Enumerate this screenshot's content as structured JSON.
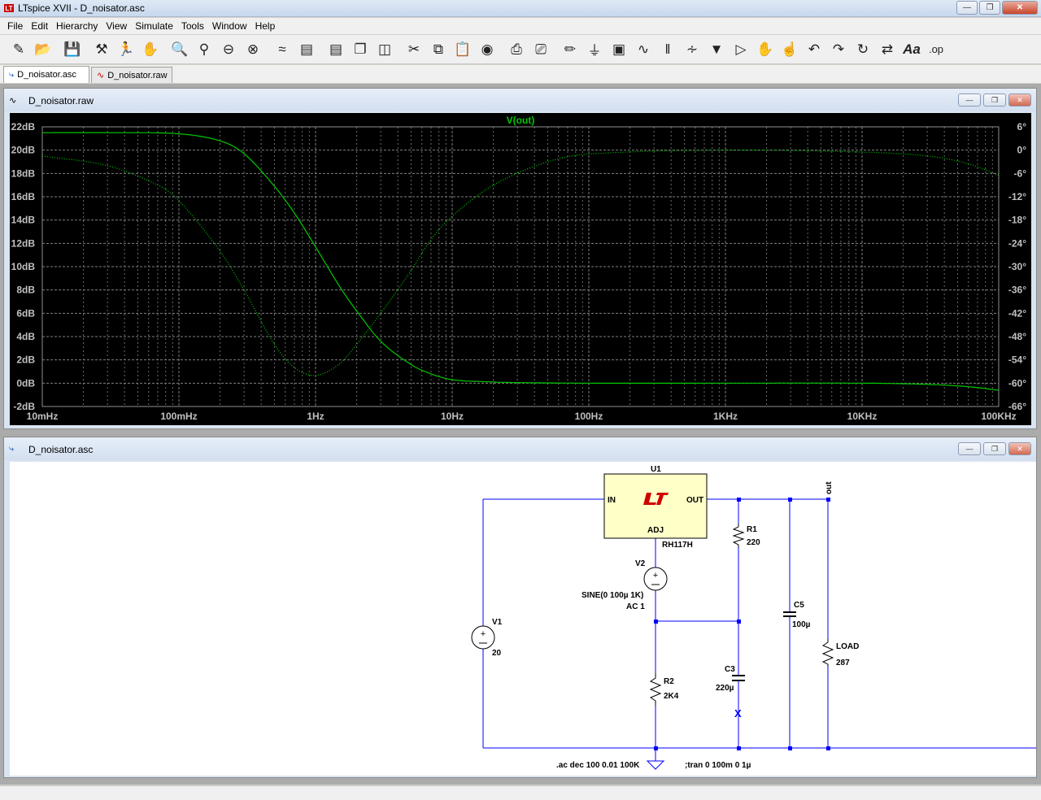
{
  "window": {
    "title": "LTspice XVII - D_noisator.asc"
  },
  "menu": [
    "File",
    "Edit",
    "Hierarchy",
    "View",
    "Simulate",
    "Tools",
    "Window",
    "Help"
  ],
  "tabs": [
    {
      "label": "D_noisator.asc",
      "active": true
    },
    {
      "label": "D_noisator.raw",
      "active": false
    }
  ],
  "plot_window": {
    "title": "D_noisator.raw"
  },
  "schematic_window": {
    "title": "D_noisator.asc"
  },
  "chart_data": {
    "type": "line",
    "title": "V(out)",
    "x_scale": "log",
    "xlim_hz": [
      0.01,
      100000
    ],
    "x_tick_labels": [
      "10mHz",
      "100mHz",
      "1Hz",
      "10Hz",
      "100Hz",
      "1KHz",
      "10KHz",
      "100KHz"
    ],
    "ylim_db": [
      -2,
      22
    ],
    "y_tick_labels": [
      "22dB",
      "20dB",
      "18dB",
      "16dB",
      "14dB",
      "12dB",
      "10dB",
      "8dB",
      "6dB",
      "4dB",
      "2dB",
      "0dB",
      "-2dB"
    ],
    "y2lim_deg": [
      -66,
      6
    ],
    "y2_tick_labels": [
      "6°",
      "0°",
      "-6°",
      "-12°",
      "-18°",
      "-24°",
      "-30°",
      "-36°",
      "-42°",
      "-48°",
      "-54°",
      "-60°",
      "-66°"
    ],
    "grid": true,
    "series": [
      {
        "name": "V(out)",
        "axis": "magnitude",
        "unit": "dB",
        "color": "#00c800",
        "x": [
          0.01,
          0.03,
          0.1,
          0.2,
          0.3,
          0.5,
          0.7,
          1,
          1.5,
          2,
          3,
          5,
          7,
          10,
          20,
          30,
          100,
          1000,
          10000,
          30000,
          60000,
          100000
        ],
        "y": [
          21.5,
          21.5,
          21.4,
          20.8,
          19.7,
          16.9,
          14.6,
          11.7,
          8.3,
          6.2,
          3.6,
          1.6,
          0.8,
          0.3,
          0.1,
          0.05,
          0.0,
          0.0,
          0.0,
          -0.1,
          -0.3,
          -0.6
        ]
      },
      {
        "name": "V(out) phase",
        "axis": "phase",
        "unit": "deg",
        "color": "#00c800",
        "dotted": true,
        "x": [
          0.01,
          0.03,
          0.07,
          0.1,
          0.2,
          0.3,
          0.5,
          0.7,
          1,
          1.5,
          2,
          3,
          5,
          7,
          10,
          20,
          50,
          100,
          1000,
          10000,
          30000,
          60000,
          100000
        ],
        "y": [
          -1.5,
          -4,
          -9,
          -13,
          -26,
          -36,
          -50,
          -56,
          -58,
          -55,
          -50,
          -42,
          -31,
          -23,
          -17,
          -9,
          -3,
          -1,
          0,
          -0.5,
          -1.5,
          -3.5,
          -6.5
        ]
      }
    ]
  },
  "schematic": {
    "regulator": {
      "ref": "U1",
      "part": "RH117H",
      "pin_in": "IN",
      "pin_out": "OUT",
      "pin_adj": "ADJ"
    },
    "V1": {
      "ref": "V1",
      "value": "20"
    },
    "V2": {
      "ref": "V2",
      "value": "SINE(0 100µ 1K)",
      "ac": "AC 1"
    },
    "R1": {
      "ref": "R1",
      "value": "220"
    },
    "R2": {
      "ref": "R2",
      "value": "2K4"
    },
    "C3": {
      "ref": "C3",
      "value": "220µ"
    },
    "C5": {
      "ref": "C5",
      "value": "100µ"
    },
    "LOAD": {
      "ref": "LOAD",
      "value": "287"
    },
    "net_out": "out",
    "marker_x": "X",
    "directive_ac": ".ac dec 100 0.01 100K",
    "directive_tran": ";tran 0 100m 0 1µ"
  }
}
